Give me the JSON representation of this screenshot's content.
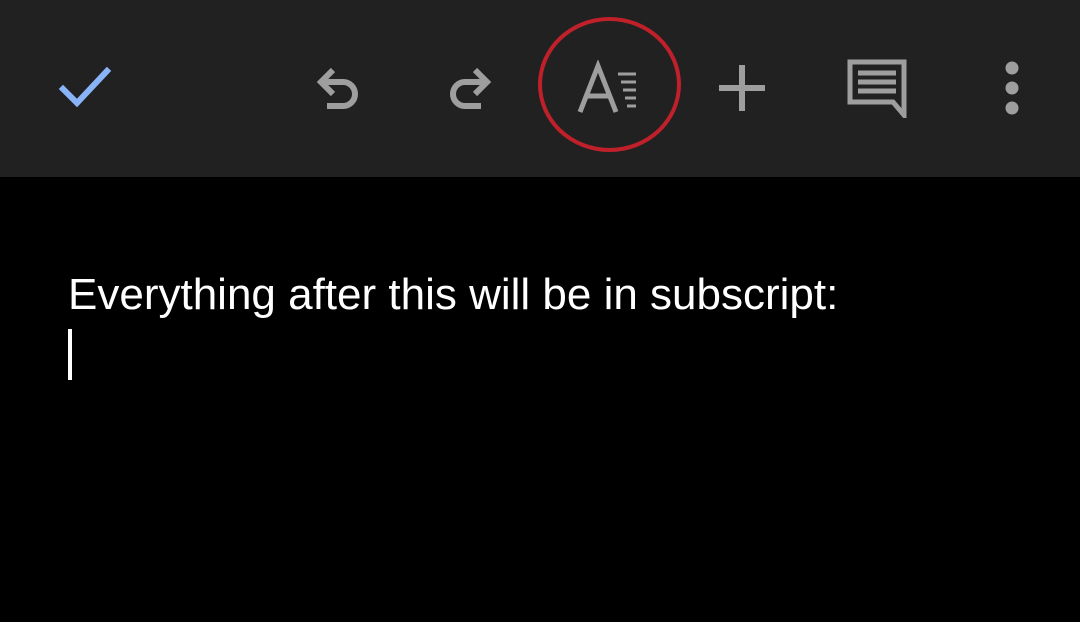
{
  "toolbar": {
    "background": "#212121",
    "buttons": [
      {
        "id": "done",
        "icon": "check-icon",
        "color": "#8ab4f8"
      },
      {
        "id": "undo",
        "icon": "undo-icon",
        "color": "#9e9e9e"
      },
      {
        "id": "redo",
        "icon": "redo-icon",
        "color": "#9e9e9e"
      },
      {
        "id": "format",
        "icon": "text-format-icon",
        "color": "#9e9e9e",
        "highlighted": true
      },
      {
        "id": "insert",
        "icon": "plus-icon",
        "color": "#9e9e9e"
      },
      {
        "id": "comment",
        "icon": "comment-icon",
        "color": "#9e9e9e"
      },
      {
        "id": "more",
        "icon": "more-vertical-icon",
        "color": "#9e9e9e"
      }
    ],
    "highlight_color": "#c0202a"
  },
  "document": {
    "background": "#000000",
    "text_color": "#ffffff",
    "line_1": "Everything after this will be in subscript:"
  }
}
